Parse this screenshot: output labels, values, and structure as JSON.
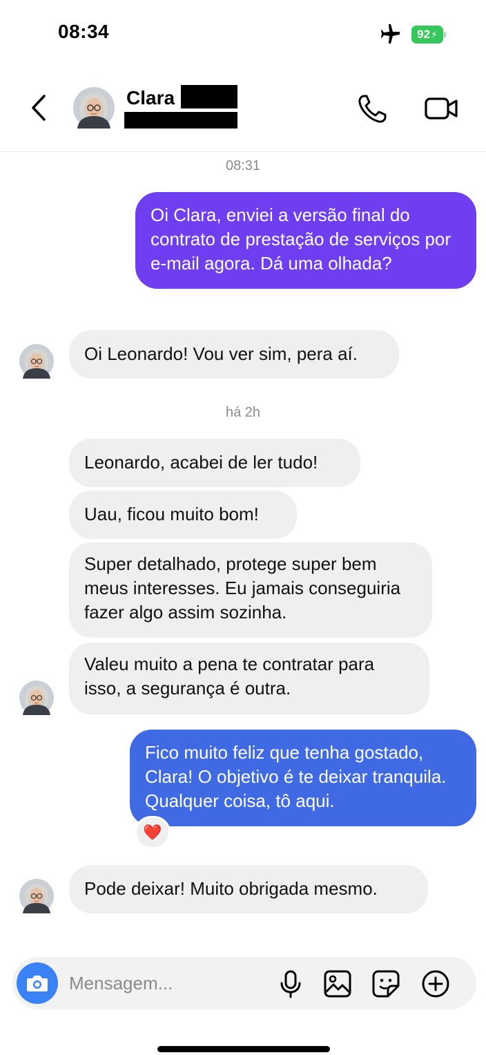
{
  "status_bar": {
    "time": "08:34",
    "battery": "92"
  },
  "header": {
    "contact_name": "Clara"
  },
  "messages": {
    "ts1": "08:31",
    "m1": "Oi Clara, enviei a versão final do contrato de prestação de serviços por e-mail agora. Dá uma olhada?",
    "m2": "Oi Leonardo! Vou ver sim, pera aí.",
    "ts2": "há 2h",
    "m3": "Leonardo, acabei de ler tudo!",
    "m4": "Uau, ficou muito bom!",
    "m5": "Super detalhado, protege super bem meus interesses. Eu jamais conseguiria fazer algo assim sozinha.",
    "m6": "Valeu muito a pena te contratar para isso, a segurança é outra.",
    "m7": "Fico muito feliz que tenha gostado, Clara! O objetivo é te deixar tranquila. Qualquer coisa, tô aqui.",
    "m7_reaction": "❤️",
    "m8": "Pode deixar! Muito obrigada mesmo."
  },
  "composer": {
    "placeholder": "Mensagem..."
  },
  "icons": [
    "airplane-icon",
    "battery-icon",
    "back-icon",
    "phone-icon",
    "video-icon",
    "camera-icon",
    "microphone-icon",
    "image-icon",
    "sticker-icon",
    "plus-icon"
  ],
  "colors": {
    "outgoing_purple": "#6e3ef0",
    "outgoing_blue": "#3f6ae3",
    "incoming": "#efefef",
    "camera_button": "#3b82f6",
    "battery": "#34c759"
  }
}
